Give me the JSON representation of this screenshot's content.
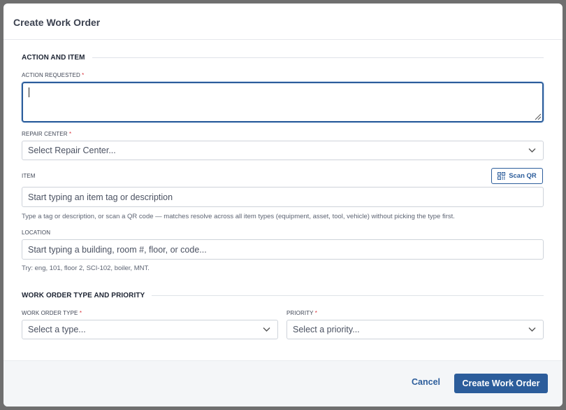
{
  "modal": {
    "title": "Create Work Order"
  },
  "sections": {
    "action_item": "ACTION AND ITEM",
    "type_priority": "WORK ORDER TYPE AND PRIORITY"
  },
  "fields": {
    "action_requested": {
      "label": "ACTION REQUESTED",
      "required": "*",
      "value": ""
    },
    "repair_center": {
      "label": "REPAIR CENTER",
      "required": "*",
      "placeholder": "Select Repair Center..."
    },
    "item": {
      "label": "ITEM",
      "placeholder": "Start typing an item tag or description",
      "hint": "Type a tag or description, or scan a QR code — matches resolve across all item types (equipment, asset, tool, vehicle) without picking the type first."
    },
    "location": {
      "label": "LOCATION",
      "placeholder": "Start typing a building, room #, floor, or code...",
      "hint": "Try: eng, 101, floor 2, SCI-102, boiler, MNT."
    },
    "work_order_type": {
      "label": "WORK ORDER TYPE",
      "required": "*",
      "placeholder": "Select a type..."
    },
    "priority": {
      "label": "PRIORITY",
      "required": "*",
      "placeholder": "Select a priority..."
    }
  },
  "buttons": {
    "scan_qr": "Scan QR",
    "cancel": "Cancel",
    "create": "Create Work Order"
  },
  "icons": {
    "scan": "qr-code-icon",
    "dropdown": "chevron-down-icon",
    "resize": "resize-grip-icon"
  },
  "colors": {
    "accent": "#2c5d9b",
    "required": "#d9363e",
    "footer_bg": "#f4f6f8"
  }
}
